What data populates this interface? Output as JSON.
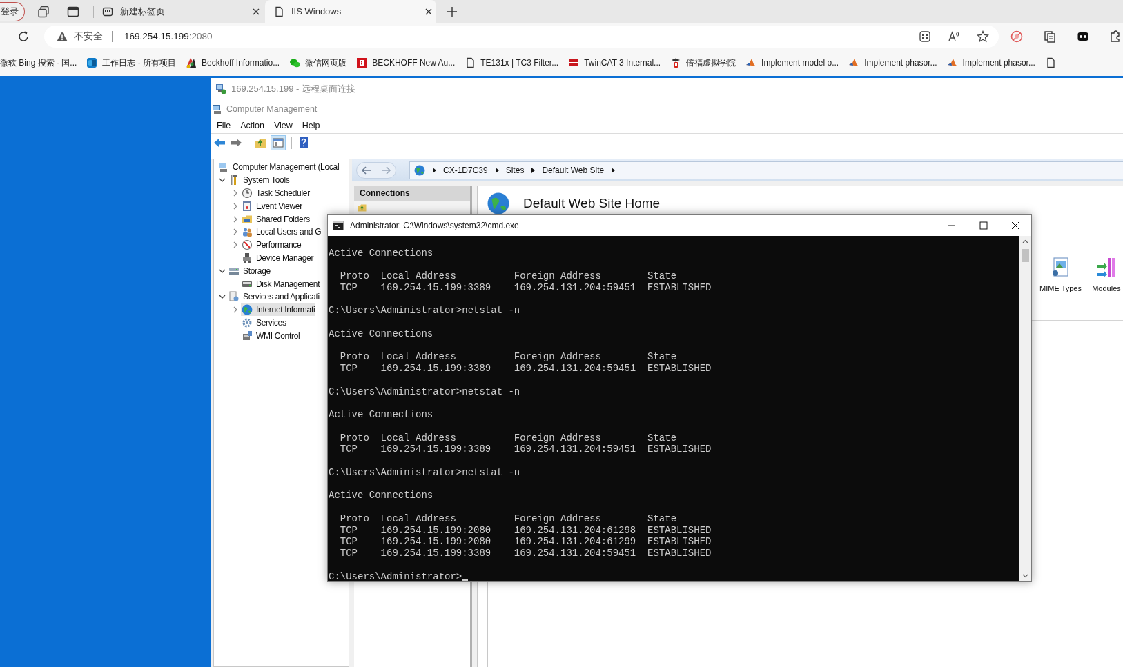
{
  "browser": {
    "signin_button": "登录",
    "tabs": [
      {
        "title": "新建标签页",
        "selected": false
      },
      {
        "title": "IIS Windows",
        "selected": true
      }
    ],
    "address": {
      "security": "不安全",
      "host": "169.254.15.199",
      "port": ":2080"
    },
    "bookmarks": [
      "微软 Bing 搜索 - 国...",
      "工作日志 - 所有项目",
      "Beckhoff Informatio...",
      "微信网页版",
      "BECKHOFF New Au...",
      "TE131x | TC3 Filter...",
      "TwinCAT 3 Internal...",
      "倍福虚拟学院",
      "Implement model o...",
      "Implement phasor...",
      "Implement phasor..."
    ]
  },
  "remote_window": {
    "title": "169.254.15.199 - 远程桌面连接"
  },
  "app": {
    "title": "Computer Management",
    "menu": [
      "File",
      "Action",
      "View",
      "Help"
    ]
  },
  "tree": [
    {
      "label": "Computer Management (Local",
      "selected": false,
      "children": [
        {
          "label": "System Tools",
          "expanded": true,
          "selected": false,
          "children": [
            {
              "label": "Task Scheduler",
              "expanded": false,
              "selected": false
            },
            {
              "label": "Event Viewer",
              "expanded": false,
              "selected": false
            },
            {
              "label": "Shared Folders",
              "expanded": false,
              "selected": false
            },
            {
              "label": "Local Users and G",
              "expanded": false,
              "selected": false
            },
            {
              "label": "Performance",
              "expanded": false,
              "selected": false
            },
            {
              "label": "Device Manager",
              "selected": false
            }
          ]
        },
        {
          "label": "Storage",
          "expanded": true,
          "selected": false,
          "children": [
            {
              "label": "Disk Management",
              "selected": false
            }
          ]
        },
        {
          "label": "Services and Applicati",
          "expanded": true,
          "selected": false,
          "children": [
            {
              "label": "Internet Informati",
              "expanded": false,
              "selected": true
            },
            {
              "label": "Services",
              "selected": false
            },
            {
              "label": "WMI Control",
              "selected": false
            }
          ]
        }
      ]
    }
  ],
  "iis": {
    "breadcrumb": [
      "CX-1D7C39",
      "Sites",
      "Default Web Site"
    ],
    "connections_title": "Connections",
    "page_title": "Default Web Site Home",
    "features": [
      "MIME Types",
      "Modules"
    ]
  },
  "console": {
    "title": "Administrator: C:\\Windows\\system32\\cmd.exe",
    "blocks": [
      {
        "kind": "heading",
        "text": "Active Connections"
      },
      {
        "kind": "table",
        "columns": [
          "Proto",
          "Local Address",
          "Foreign Address",
          "State"
        ],
        "rows": [
          [
            "TCP",
            "169.254.15.199:3389",
            "169.254.131.204:59451",
            "ESTABLISHED"
          ]
        ]
      },
      {
        "kind": "prompt",
        "text": "C:\\Users\\Administrator>netstat -n",
        "cursor": false
      },
      {
        "kind": "heading",
        "text": "Active Connections"
      },
      {
        "kind": "table",
        "columns": [
          "Proto",
          "Local Address",
          "Foreign Address",
          "State"
        ],
        "rows": [
          [
            "TCP",
            "169.254.15.199:3389",
            "169.254.131.204:59451",
            "ESTABLISHED"
          ]
        ]
      },
      {
        "kind": "prompt",
        "text": "C:\\Users\\Administrator>netstat -n",
        "cursor": false
      },
      {
        "kind": "heading",
        "text": "Active Connections"
      },
      {
        "kind": "table",
        "columns": [
          "Proto",
          "Local Address",
          "Foreign Address",
          "State"
        ],
        "rows": [
          [
            "TCP",
            "169.254.15.199:3389",
            "169.254.131.204:59451",
            "ESTABLISHED"
          ]
        ]
      },
      {
        "kind": "prompt",
        "text": "C:\\Users\\Administrator>netstat -n",
        "cursor": false
      },
      {
        "kind": "heading",
        "text": "Active Connections"
      },
      {
        "kind": "table",
        "columns": [
          "Proto",
          "Local Address",
          "Foreign Address",
          "State"
        ],
        "rows": [
          [
            "TCP",
            "169.254.15.199:2080",
            "169.254.131.204:61298",
            "ESTABLISHED"
          ],
          [
            "TCP",
            "169.254.15.199:2080",
            "169.254.131.204:61299",
            "ESTABLISHED"
          ],
          [
            "TCP",
            "169.254.15.199:3389",
            "169.254.131.204:59451",
            "ESTABLISHED"
          ]
        ]
      },
      {
        "kind": "prompt",
        "text": "C:\\Users\\Administrator>",
        "cursor": true
      }
    ]
  }
}
